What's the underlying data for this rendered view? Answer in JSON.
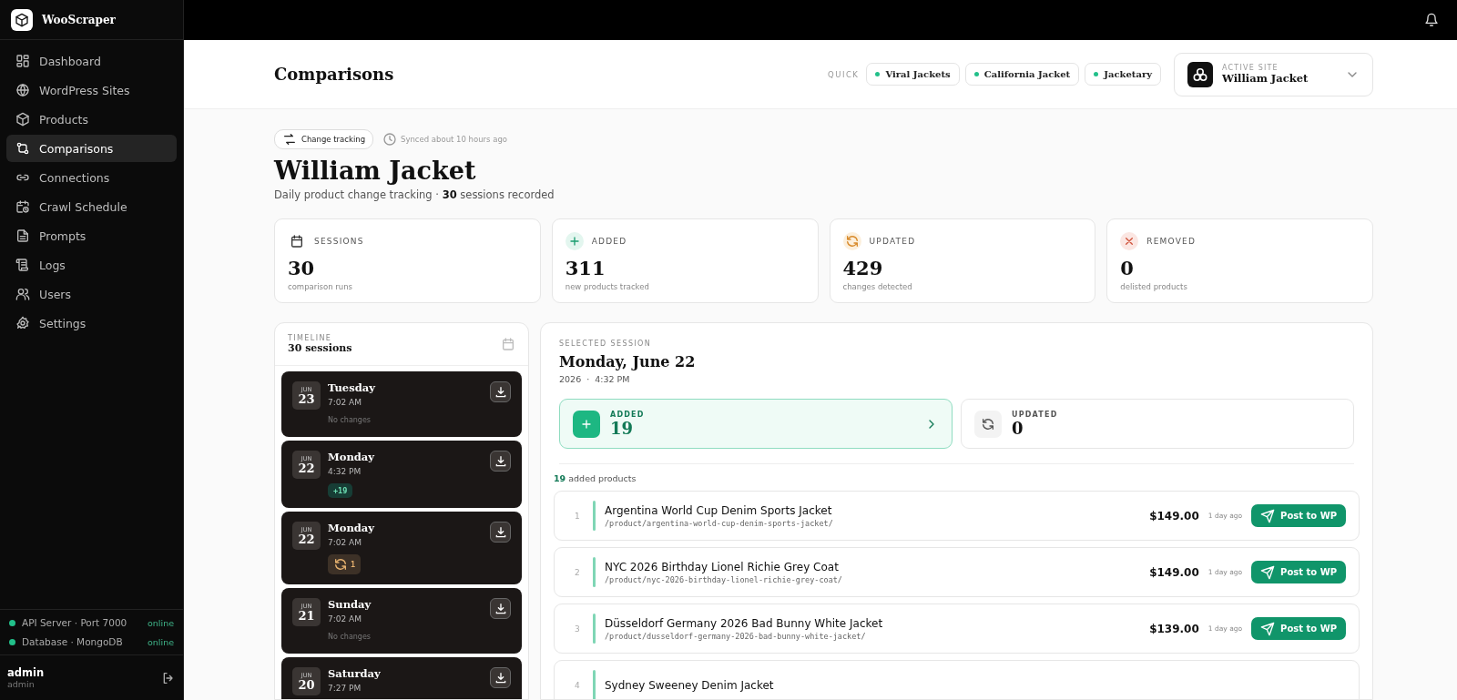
{
  "brand": "WooScraper",
  "nav": [
    {
      "label": "Dashboard",
      "selected": false
    },
    {
      "label": "WordPress Sites",
      "selected": false
    },
    {
      "label": "Products",
      "selected": false
    },
    {
      "label": "Comparisons",
      "selected": true
    },
    {
      "label": "Connections",
      "selected": false
    },
    {
      "label": "Crawl Schedule",
      "selected": false
    },
    {
      "label": "Prompts",
      "selected": false
    },
    {
      "label": "Logs",
      "selected": false
    },
    {
      "label": "Users",
      "selected": false
    },
    {
      "label": "Settings",
      "selected": false
    }
  ],
  "services": [
    {
      "name": "API Server · Port 7000",
      "status": "online",
      "color": "#22c08a"
    },
    {
      "name": "Database · MongoDB",
      "status": "online",
      "color": "#22c08a"
    }
  ],
  "user": {
    "name": "admin",
    "role": "admin"
  },
  "header": {
    "title": "Comparisons",
    "quick_label": "QUICK",
    "quick": [
      "Viral Jackets",
      "California Jacket",
      "Jacketary"
    ],
    "active_site_label": "ACTIVE SITE",
    "active_site": "William Jacket"
  },
  "hero": {
    "tag": "Change tracking",
    "synced": "Synced about 10 hours ago",
    "title": "William Jacket",
    "subtitle": "Daily product change tracking · **30** sessions recorded"
  },
  "stats": [
    {
      "kind": "sessions",
      "label": "SESSIONS",
      "value": "30",
      "caption": "comparison runs"
    },
    {
      "kind": "added",
      "label": "ADDED",
      "value": "311",
      "caption": "new products tracked"
    },
    {
      "kind": "updated",
      "label": "UPDATED",
      "value": "429",
      "caption": "changes detected"
    },
    {
      "kind": "removed",
      "label": "REMOVED",
      "value": "0",
      "caption": "delisted products"
    }
  ],
  "timeline": {
    "label": "TIMELINE",
    "count": "30 sessions",
    "sessions": [
      {
        "month": "JUN",
        "day": "23",
        "weekday": "Tuesday",
        "time": "7:02 AM",
        "change": {
          "kind": "none",
          "label": "No changes"
        }
      },
      {
        "month": "JUN",
        "day": "22",
        "weekday": "Monday",
        "time": "4:32 PM",
        "change": {
          "kind": "added",
          "label": "+19"
        }
      },
      {
        "month": "JUN",
        "day": "22",
        "weekday": "Monday",
        "time": "7:02 AM",
        "change": {
          "kind": "updated",
          "label": "1"
        }
      },
      {
        "month": "JUN",
        "day": "21",
        "weekday": "Sunday",
        "time": "7:02 AM",
        "change": {
          "kind": "none",
          "label": "No changes"
        }
      },
      {
        "month": "JUN",
        "day": "20",
        "weekday": "Saturday",
        "time": "7:27 PM"
      }
    ]
  },
  "session": {
    "label": "SELECTED SESSION",
    "title": "Monday, June 22",
    "year": "2026",
    "separator": "·",
    "time": "4:32 PM",
    "filters": [
      {
        "kind": "added",
        "label": "ADDED",
        "value": "19",
        "selected": true
      },
      {
        "kind": "updated",
        "label": "UPDATED",
        "value": "0",
        "selected": false
      }
    ],
    "list_summary": "**19** added products",
    "products": [
      {
        "index": "1",
        "name": "Argentina World Cup Denim Sports Jacket",
        "path": "/product/argentina-world-cup-denim-sports-jacket/",
        "price": "$149.00",
        "age": "1 day ago",
        "action": "Post to WP"
      },
      {
        "index": "2",
        "name": "NYC 2026 Birthday Lionel Richie Grey Coat",
        "path": "/product/nyc-2026-birthday-lionel-richie-grey-coat/",
        "price": "$149.00",
        "age": "1 day ago",
        "action": "Post to WP"
      },
      {
        "index": "3",
        "name": "Düsseldorf Germany 2026 Bad Bunny White Jacket",
        "path": "/product/dusseldorf-germany-2026-bad-bunny-white-jacket/",
        "price": "$139.00",
        "age": "1 day ago",
        "action": "Post to WP"
      },
      {
        "index": "4",
        "name": "Sydney Sweeney Denim Jacket"
      }
    ]
  }
}
